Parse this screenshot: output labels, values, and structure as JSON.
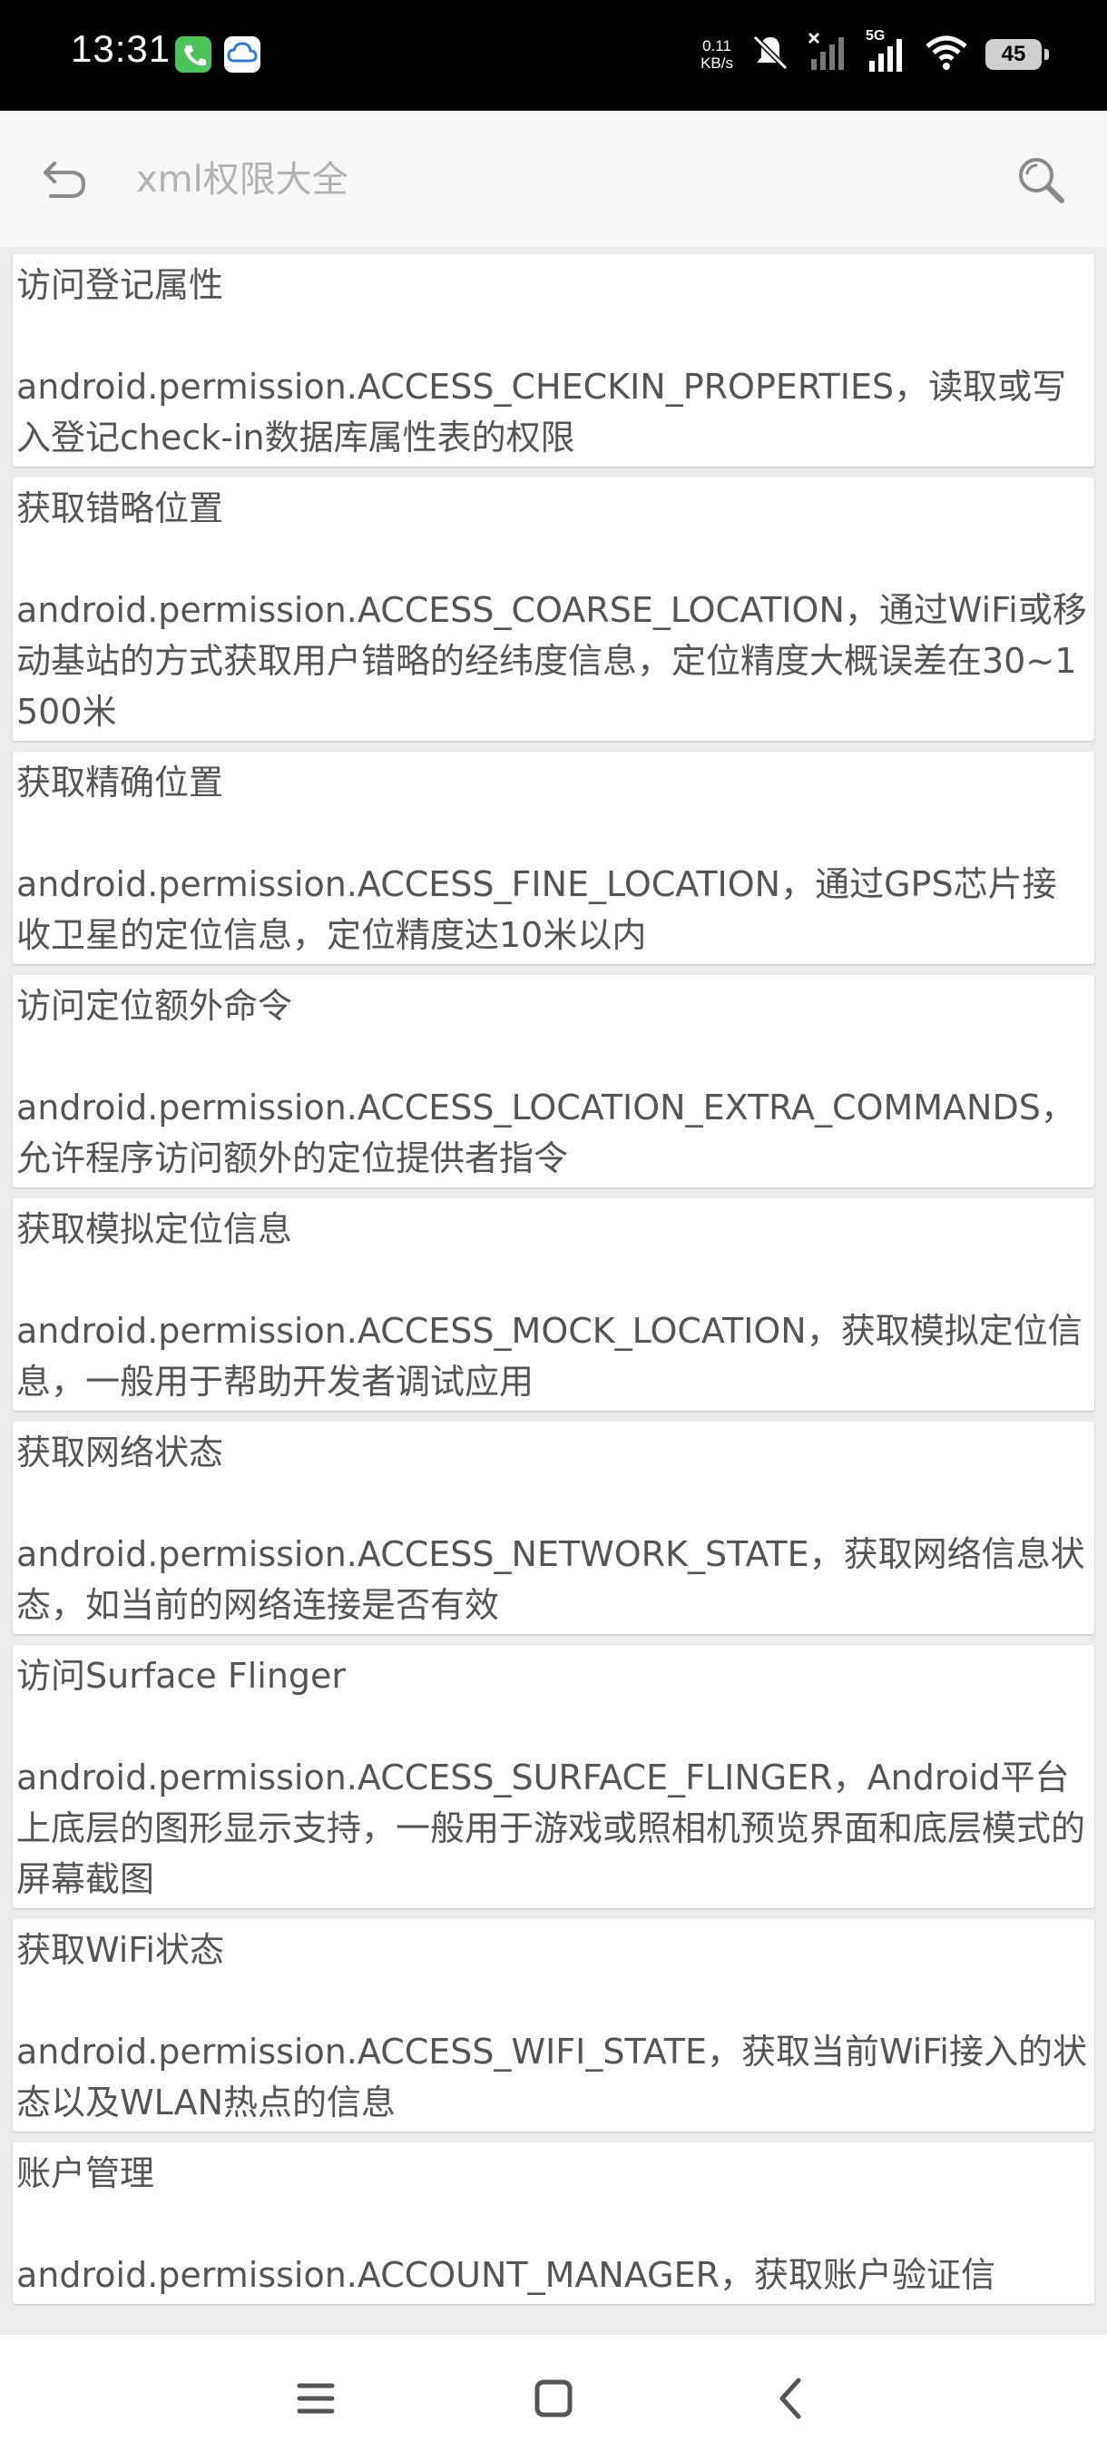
{
  "status_bar": {
    "time": "13:31",
    "net_speed_value": "0.11",
    "net_speed_unit": "KB/s",
    "network_type": "5G",
    "battery": "45"
  },
  "toolbar": {
    "search_placeholder": "xml权限大全"
  },
  "permissions": [
    {
      "title": "访问登记属性",
      "description": "android.permission.ACCESS_CHECKIN_PROPERTIES，读取或写入登记check-in数据库属性表的权限"
    },
    {
      "title": "获取错略位置",
      "description": "android.permission.ACCESS_COARSE_LOCATION，通过WiFi或移动基站的方式获取用户错略的经纬度信息，定位精度大概误差在30~1500米"
    },
    {
      "title": "获取精确位置",
      "description": "android.permission.ACCESS_FINE_LOCATION，通过GPS芯片接收卫星的定位信息，定位精度达10米以内"
    },
    {
      "title": "访问定位额外命令",
      "description": "android.permission.ACCESS_LOCATION_EXTRA_COMMANDS，允许程序访问额外的定位提供者指令"
    },
    {
      "title": "获取模拟定位信息",
      "description": "android.permission.ACCESS_MOCK_LOCATION，获取模拟定位信息，一般用于帮助开发者调试应用"
    },
    {
      "title": "获取网络状态",
      "description": "android.permission.ACCESS_NETWORK_STATE，获取网络信息状态，如当前的网络连接是否有效"
    },
    {
      "title": "访问Surface Flinger",
      "description": "android.permission.ACCESS_SURFACE_FLINGER，Android平台上底层的图形显示支持，一般用于游戏或照相机预览界面和底层模式的屏幕截图"
    },
    {
      "title": "获取WiFi状态",
      "description": "android.permission.ACCESS_WIFI_STATE，获取当前WiFi接入的状态以及WLAN热点的信息"
    },
    {
      "title": "账户管理",
      "description": "android.permission.ACCOUNT_MANAGER，获取账户验证信"
    }
  ],
  "colors": {
    "status_bar_bg": "#000000",
    "toolbar_bg": "#f7f7f7",
    "list_bg": "#ececec",
    "card_bg": "#ffffff",
    "text": "#555555",
    "placeholder": "#b2b2b2",
    "icon": "#8a8a8a"
  },
  "icons": {
    "back": "back-arrow-icon",
    "search": "search-icon",
    "nav_menu": "menu-icon",
    "nav_home": "home-icon",
    "nav_back": "back-chevron-icon"
  }
}
